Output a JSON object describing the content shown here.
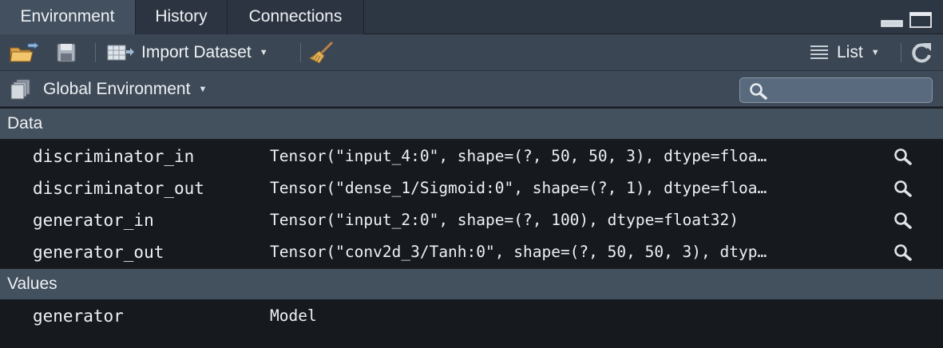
{
  "tabs": [
    {
      "label": "Environment",
      "active": true
    },
    {
      "label": "History",
      "active": false
    },
    {
      "label": "Connections",
      "active": false
    }
  ],
  "toolbar": {
    "open_icon": "open-folder-icon",
    "save_icon": "save-disk-icon",
    "import_label": "Import Dataset",
    "clear_icon": "broom-icon",
    "view_label": "List",
    "refresh_icon": "refresh-icon"
  },
  "environment": {
    "selector_label": "Global Environment",
    "search_placeholder": ""
  },
  "sections": {
    "data": {
      "title": "Data",
      "rows": [
        {
          "name": "discriminator_in",
          "value": "Tensor(\"input_4:0\", shape=(?, 50, 50, 3), dtype=floa…"
        },
        {
          "name": "discriminator_out",
          "value": "Tensor(\"dense_1/Sigmoid:0\", shape=(?, 1), dtype=floa…"
        },
        {
          "name": "generator_in",
          "value": "Tensor(\"input_2:0\", shape=(?, 100), dtype=float32)"
        },
        {
          "name": "generator_out",
          "value": "Tensor(\"conv2d_3/Tanh:0\", shape=(?, 50, 50, 3), dtyp…"
        }
      ]
    },
    "values": {
      "title": "Values",
      "rows": [
        {
          "name": "generator",
          "value": "Model"
        }
      ]
    }
  },
  "colors": {
    "tabbar_bg": "#2d3643",
    "active_tab_bg": "#43505f",
    "toolbar_bg": "#3b4654",
    "section_bg": "#43505e",
    "row_bg": "#16191e",
    "text": "#eef1f4"
  }
}
